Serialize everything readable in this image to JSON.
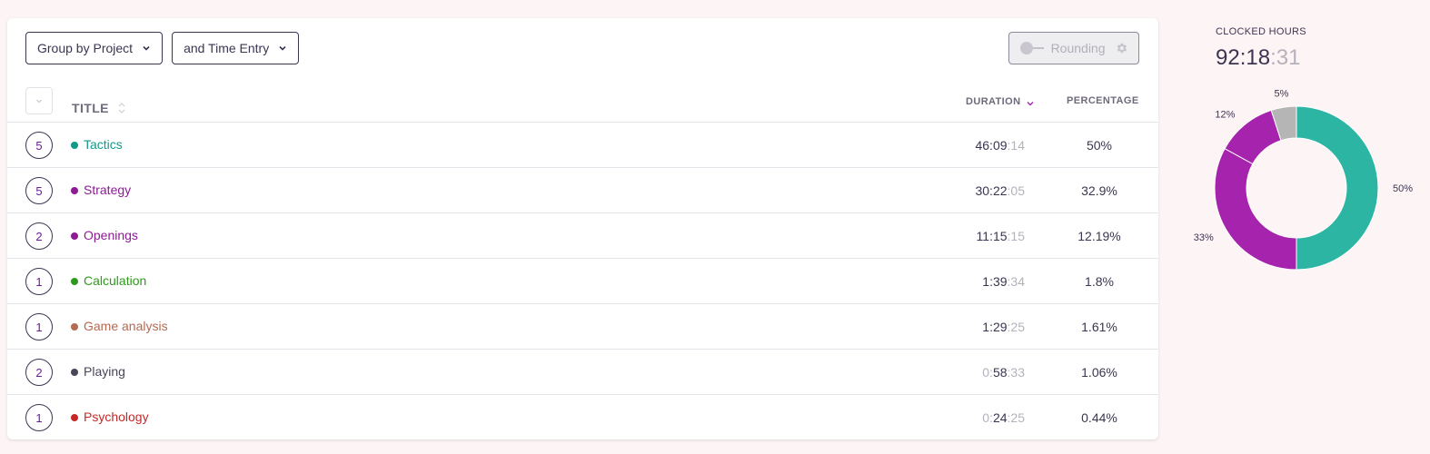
{
  "toolbar": {
    "group_by_label": "Group by Project",
    "then_by_label": "and Time Entry",
    "rounding_label": "Rounding"
  },
  "table": {
    "headers": {
      "title": "TITLE",
      "duration": "DURATION",
      "percentage": "PERCENTAGE"
    },
    "rows": [
      {
        "count": "5",
        "title": "Tactics",
        "color": "#119a8a",
        "dur_lead": "",
        "dur_main": "46:09",
        "dur_sec": ":14",
        "percentage": "50%"
      },
      {
        "count": "5",
        "title": "Strategy",
        "color": "#8e1a96",
        "dur_lead": "",
        "dur_main": "30:22",
        "dur_sec": ":05",
        "percentage": "32.9%"
      },
      {
        "count": "2",
        "title": "Openings",
        "color": "#8e1a96",
        "dur_lead": "",
        "dur_main": "11:15",
        "dur_sec": ":15",
        "percentage": "12.19%"
      },
      {
        "count": "1",
        "title": "Calculation",
        "color": "#2e9a1c",
        "dur_lead": "",
        "dur_main": "1:39",
        "dur_sec": ":34",
        "percentage": "1.8%"
      },
      {
        "count": "1",
        "title": "Game analysis",
        "color": "#b56a52",
        "dur_lead": "",
        "dur_main": "1:29",
        "dur_sec": ":25",
        "percentage": "1.61%"
      },
      {
        "count": "2",
        "title": "Playing",
        "color": "#4a4558",
        "dur_lead": "0:",
        "dur_main": "58",
        "dur_sec": ":33",
        "percentage": "1.06%"
      },
      {
        "count": "1",
        "title": "Psychology",
        "color": "#c62828",
        "dur_lead": "0:",
        "dur_main": "24",
        "dur_sec": ":25",
        "percentage": "0.44%"
      }
    ]
  },
  "summary": {
    "label": "CLOCKED HOURS",
    "value_main": "92:18",
    "value_sec": ":31"
  },
  "chart_data": {
    "type": "pie",
    "slices": [
      {
        "label": "50%",
        "value": 50,
        "color": "#2db5a3"
      },
      {
        "label": "33%",
        "value": 33,
        "color": "#a523ad"
      },
      {
        "label": "12%",
        "value": 12,
        "color": "#a523ad"
      },
      {
        "label": "5%",
        "value": 5,
        "color": "#b5b5b5"
      }
    ],
    "donut": true
  }
}
